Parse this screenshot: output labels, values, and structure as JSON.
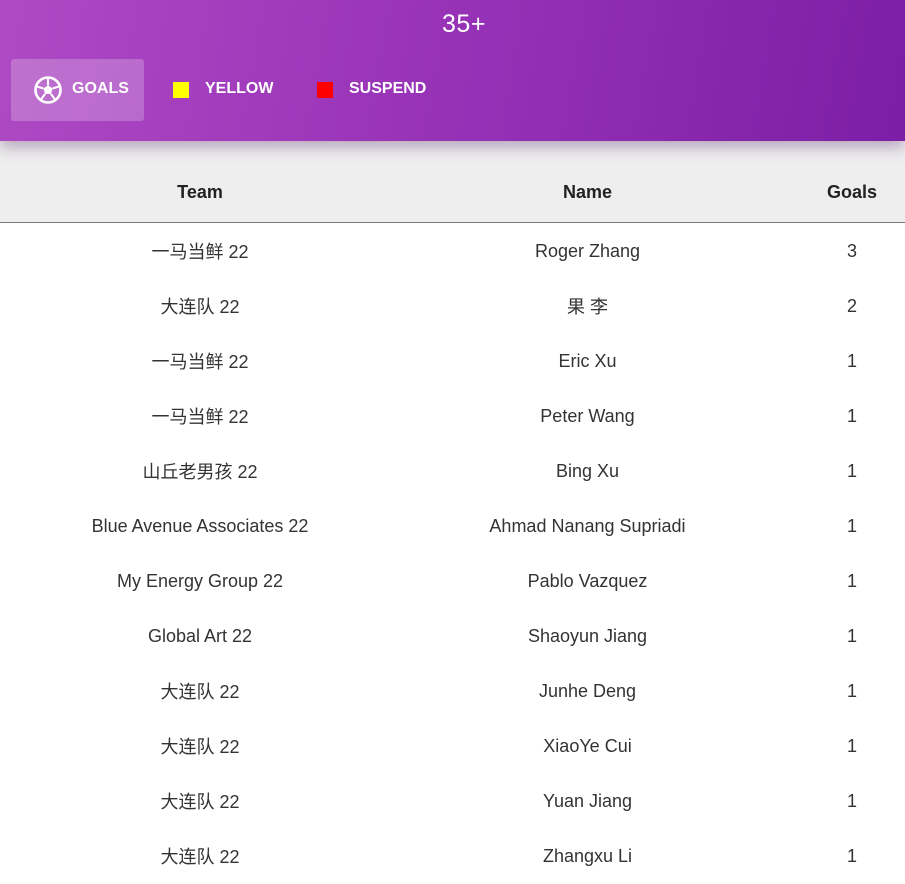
{
  "header": {
    "title": "35+",
    "tabs": [
      {
        "label": "GOALS",
        "icon": "soccer-ball-icon",
        "active": true
      },
      {
        "label": "YELLOW",
        "swatch_color": "#ffff00",
        "active": false
      },
      {
        "label": "SUSPEND",
        "swatch_color": "#ff0000",
        "active": false
      }
    ],
    "gradient_colors": [
      "#ae4ac3",
      "#7c1ea6"
    ]
  },
  "table": {
    "columns": [
      "Team",
      "Name",
      "Goals"
    ],
    "rows": [
      {
        "team": "一马当鲜 22",
        "name": "Roger Zhang",
        "goals": "3"
      },
      {
        "team": "大连队 22",
        "name": "果 李",
        "goals": "2"
      },
      {
        "team": "一马当鲜 22",
        "name": "Eric Xu",
        "goals": "1"
      },
      {
        "team": "一马当鲜 22",
        "name": "Peter Wang",
        "goals": "1"
      },
      {
        "team": "山丘老男孩 22",
        "name": "Bing Xu",
        "goals": "1"
      },
      {
        "team": "Blue Avenue Associates 22",
        "name": "Ahmad Nanang Supriadi",
        "goals": "1"
      },
      {
        "team": "My Energy Group 22",
        "name": "Pablo Vazquez",
        "goals": "1"
      },
      {
        "team": "Global Art 22",
        "name": "Shaoyun Jiang",
        "goals": "1"
      },
      {
        "team": "大连队 22",
        "name": "Junhe Deng",
        "goals": "1"
      },
      {
        "team": "大连队 22",
        "name": "XiaoYe Cui",
        "goals": "1"
      },
      {
        "team": "大连队 22",
        "name": "Yuan Jiang",
        "goals": "1"
      },
      {
        "team": "大连队 22",
        "name": "Zhangxu Li",
        "goals": "1"
      }
    ]
  }
}
